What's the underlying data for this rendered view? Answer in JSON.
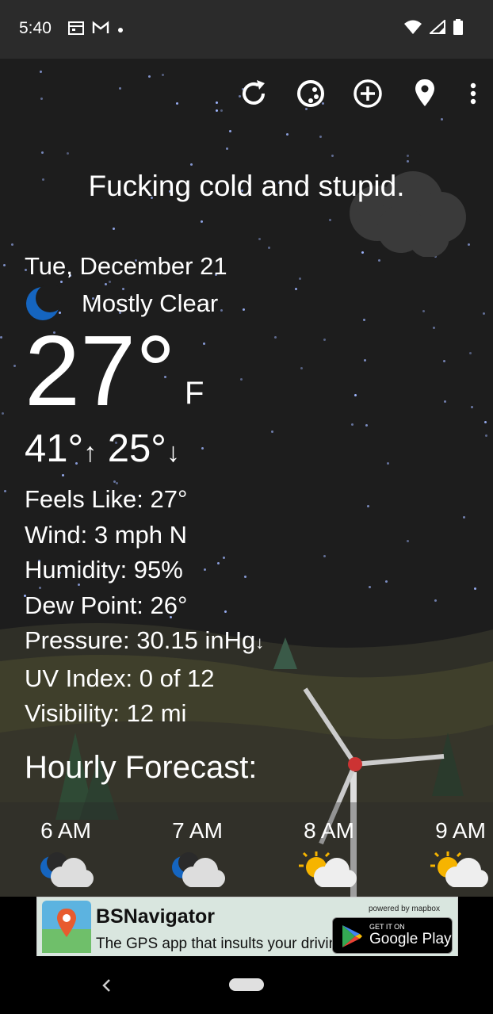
{
  "status": {
    "time": "5:40"
  },
  "headline": "Fucking cold and stupid.",
  "current": {
    "date": "Tue, December 21",
    "condition": "Mostly Clear",
    "temp": "27°",
    "unit": "F",
    "high": "41°",
    "low": "25°",
    "details": [
      "Feels Like:  27°",
      "Wind:  3 mph N",
      "Humidity:  95%",
      "Dew Point:  26°",
      "Pressure:  30.15 inHg",
      "UV Index:  0 of 12",
      "Visibility:  12 mi"
    ]
  },
  "hourly": {
    "title": "Hourly Forecast:",
    "items": [
      {
        "time": "6 AM",
        "icon": "moon-cloud-icon"
      },
      {
        "time": "7 AM",
        "icon": "moon-cloud-icon"
      },
      {
        "time": "8 AM",
        "icon": "sun-cloud-icon"
      },
      {
        "time": "9 AM",
        "icon": "sun-cloud-icon"
      }
    ]
  },
  "ad": {
    "title": "BSNavigator",
    "subtitle": "The GPS app that insults your driving.",
    "powered": "powered by mapbox",
    "store_small": "GET IT ON",
    "store_big": "Google Play"
  },
  "colors": {
    "moon": "#1565c0",
    "accent": "#ffffff"
  }
}
